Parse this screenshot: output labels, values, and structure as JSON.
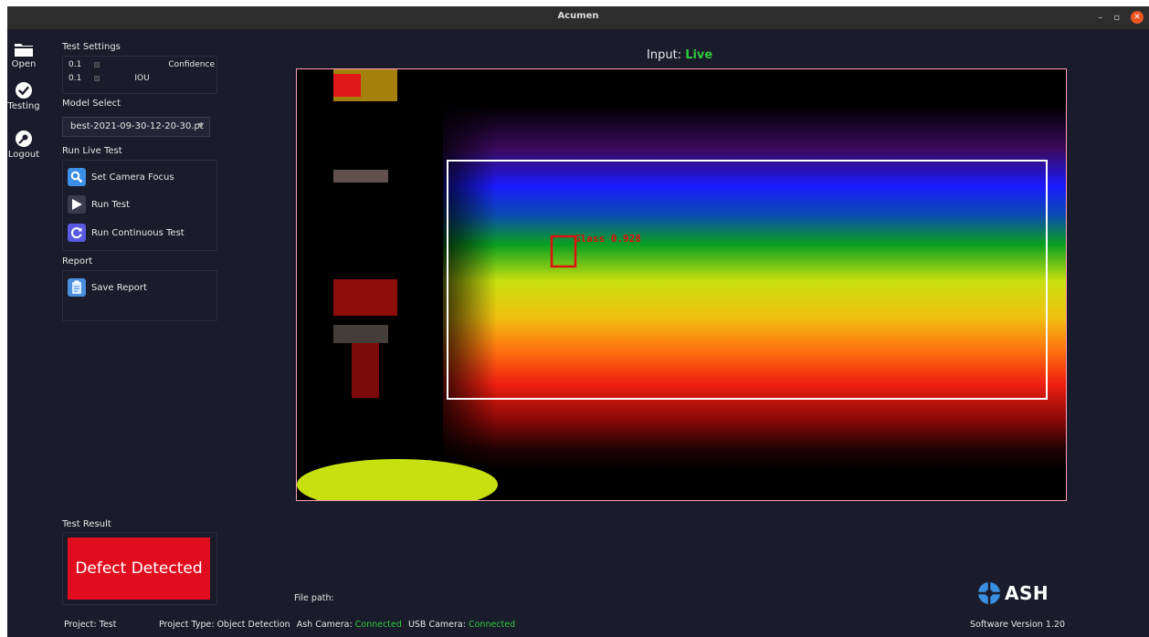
{
  "window": {
    "title": "Acumen",
    "minimize": "–",
    "maximize": "▫",
    "close": "✕"
  },
  "nav": [
    {
      "label": "Open",
      "icon": "folder-icon"
    },
    {
      "label": "Testing",
      "icon": "checkmark-icon"
    },
    {
      "label": "Logout",
      "icon": "key-icon"
    }
  ],
  "test_settings": {
    "label": "Test Settings",
    "confidence": {
      "value": "0.1",
      "label": "Confidence"
    },
    "iou": {
      "value": "0.1",
      "label": "IOU"
    }
  },
  "model_select": {
    "label": "Model Select",
    "value": "best-2021-09-30-12-20-30.pt"
  },
  "run_live_test": {
    "label": "Run Live Test",
    "buttons": [
      {
        "label": "Set Camera Focus",
        "icon": "magnifier-icon"
      },
      {
        "label": "Run Test",
        "icon": "play-icon"
      },
      {
        "label": "Run Continuous Test",
        "icon": "refresh-icon"
      }
    ]
  },
  "report": {
    "label": "Report",
    "button": {
      "label": "Save Report",
      "icon": "clipboard-icon"
    }
  },
  "test_result": {
    "label": "Test Result",
    "value": "Defect Detected",
    "color": "#e00d1f"
  },
  "input": {
    "prefix": "Input:",
    "status": "Live",
    "status_color": "#2ec83a"
  },
  "detection": {
    "label": "Glass 0.928",
    "box_color": "#e01010"
  },
  "file_path": {
    "label": "File path:"
  },
  "status_bar": {
    "project_label": "Project:",
    "project": "Test",
    "type_label": "Project Type:",
    "type": "Object Detection",
    "ash_camera_label": "Ash Camera:",
    "ash_camera": "Connected",
    "usb_camera_label": "USB Camera:",
    "usb_camera": "Connected",
    "version": "Software Version 1.20"
  },
  "logo": {
    "text": "ASH"
  },
  "colors": {
    "background": "#1b1c2b",
    "accent_green": "#2ec83a",
    "video_border": "#ff9fb4"
  }
}
